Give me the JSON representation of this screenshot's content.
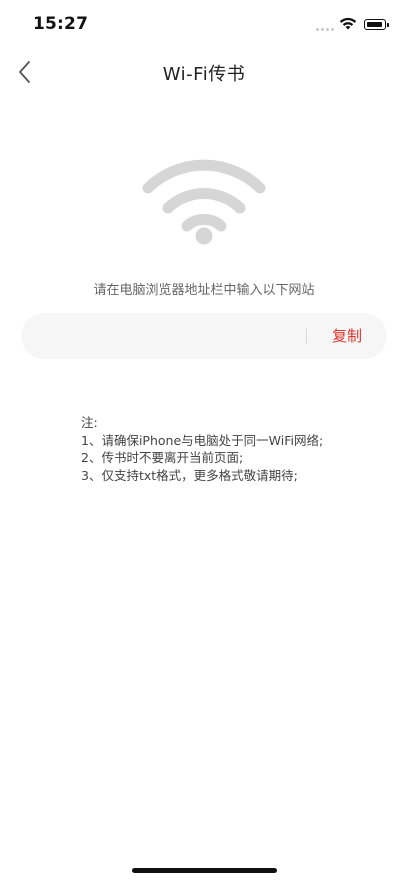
{
  "status_bar": {
    "time": "15:27",
    "wifi_icon": "wifi-icon",
    "battery_icon": "battery-icon"
  },
  "nav": {
    "back_icon": "chevron-left-icon",
    "title": "Wi-Fi传书"
  },
  "illustration": {
    "icon": "wifi-icon",
    "color": "#d6d6d6"
  },
  "instruction": "请在电脑浏览器地址栏中输入以下网站",
  "url_box": {
    "value": "",
    "copy_label": "复制",
    "accent_color": "#e0342c"
  },
  "notes": {
    "heading": "注:",
    "items": [
      "1、请确保iPhone与电脑处于同一WiFi网络;",
      "2、传书时不要离开当前页面;",
      "3、仅支持txt格式，更多格式敬请期待;"
    ]
  }
}
